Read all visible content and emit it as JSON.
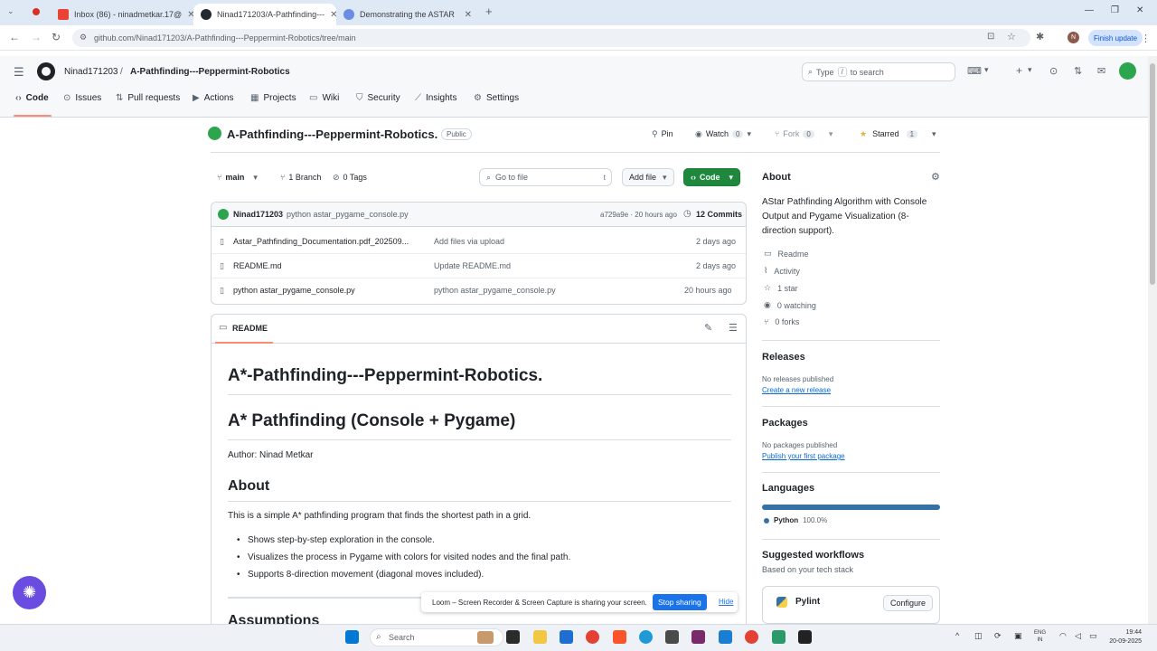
{
  "browser": {
    "tabs": [
      {
        "label": "Inbox (86) - ninadmetkar.17@",
        "active": false
      },
      {
        "label": "Ninad171203/A-Pathfinding---",
        "active": true
      },
      {
        "label": "Demonstrating the ASTAR",
        "active": false
      }
    ],
    "new_tab": "+",
    "url": "github.com/Ninad171203/A-Pathfinding---Peppermint-Robotics/tree/main",
    "profile_initial": "N",
    "finish_update": "Finish update"
  },
  "header": {
    "owner": "Ninad171203",
    "separator": "/",
    "repo": "A-Pathfinding---Peppermint-Robotics",
    "search_placeholder_pre": "Type",
    "search_key": "/",
    "search_placeholder_post": "to search"
  },
  "repo_nav": [
    {
      "label": "Code",
      "icon": "code-icon"
    },
    {
      "label": "Issues",
      "icon": "issue-icon"
    },
    {
      "label": "Pull requests",
      "icon": "pull-request-icon"
    },
    {
      "label": "Actions",
      "icon": "play-icon"
    },
    {
      "label": "Projects",
      "icon": "table-icon"
    },
    {
      "label": "Wiki",
      "icon": "book-icon"
    },
    {
      "label": "Security",
      "icon": "shield-icon"
    },
    {
      "label": "Insights",
      "icon": "graph-icon"
    },
    {
      "label": "Settings",
      "icon": "gear-icon"
    }
  ],
  "repo_title": {
    "name": "A-Pathfinding---Peppermint-Robotics.",
    "visibility": "Public",
    "pin": "Pin",
    "watch": "Watch",
    "watch_count": "0",
    "fork": "Fork",
    "fork_count": "0",
    "starred": "Starred",
    "star_count": "1"
  },
  "toolbar": {
    "branch": "main",
    "branches": "1 Branch",
    "tags": "0 Tags",
    "goto_placeholder": "Go to file",
    "goto_key": "t",
    "add_file": "Add file",
    "code": "Code"
  },
  "commit": {
    "author": "Ninad171203",
    "message": "python astar_pygame_console.py",
    "hash_time": "a729a9e · 20 hours ago",
    "commits": "12 Commits"
  },
  "files": [
    {
      "name": "Astar_Pathfinding_Documentation.pdf_202509...",
      "message": "Add files via upload",
      "time": "2 days ago"
    },
    {
      "name": "README.md",
      "message": "Update README.md",
      "time": "2 days ago"
    },
    {
      "name": "python astar_pygame_console.py",
      "message": "python astar_pygame_console.py",
      "time": "20 hours ago"
    }
  ],
  "readme": {
    "label": "README",
    "h1": "A*-Pathfinding---Peppermint-Robotics.",
    "h2": "A* Pathfinding (Console + Pygame)",
    "author": "Author: Ninad Metkar",
    "about_heading": "About",
    "about_text": "This is a simple A* pathfinding program that finds the shortest path in a grid.",
    "bullets": [
      "Shows step-by-step exploration in the console.",
      "Visualizes the process in Pygame with colors for visited nodes and the final path.",
      "Supports 8-direction movement (diagonal moves included)."
    ],
    "next_heading": "Assumptions"
  },
  "sidebar": {
    "about_heading": "About",
    "description": "AStar Pathfinding Algorithm with Console Output and Pygame Visualization (8-direction support).",
    "items": [
      {
        "label": "Readme",
        "icon": "book-icon"
      },
      {
        "label": "Activity",
        "icon": "pulse-icon"
      },
      {
        "label": "1 star",
        "icon": "star-icon"
      },
      {
        "label": "0 watching",
        "icon": "eye-icon"
      },
      {
        "label": "0 forks",
        "icon": "fork-icon"
      }
    ],
    "releases_heading": "Releases",
    "releases_none": "No releases published",
    "releases_link": "Create a new release",
    "packages_heading": "Packages",
    "packages_none": "No packages published",
    "packages_link": "Publish your first package",
    "languages_heading": "Languages",
    "language_name": "Python",
    "language_pct": "100.0%",
    "language_fraction": 1.0,
    "language_color": "#3572A5",
    "workflows_heading": "Suggested workflows",
    "workflows_sub": "Based on your tech stack",
    "workflow_name": "Pylint",
    "workflow_button": "Configure"
  },
  "loom": {
    "message": "Loom – Screen Recorder & Screen Capture is sharing your screen.",
    "stop": "Stop sharing",
    "hide": "Hide"
  },
  "taskbar": {
    "search": "Search",
    "lang_top": "ENG",
    "lang_bottom": "IN",
    "time": "19:44",
    "date": "20-09-2025"
  },
  "colors": {
    "primary_green": "#1f883d",
    "link_blue": "#0969da",
    "underline_orange": "#fd8c73"
  }
}
